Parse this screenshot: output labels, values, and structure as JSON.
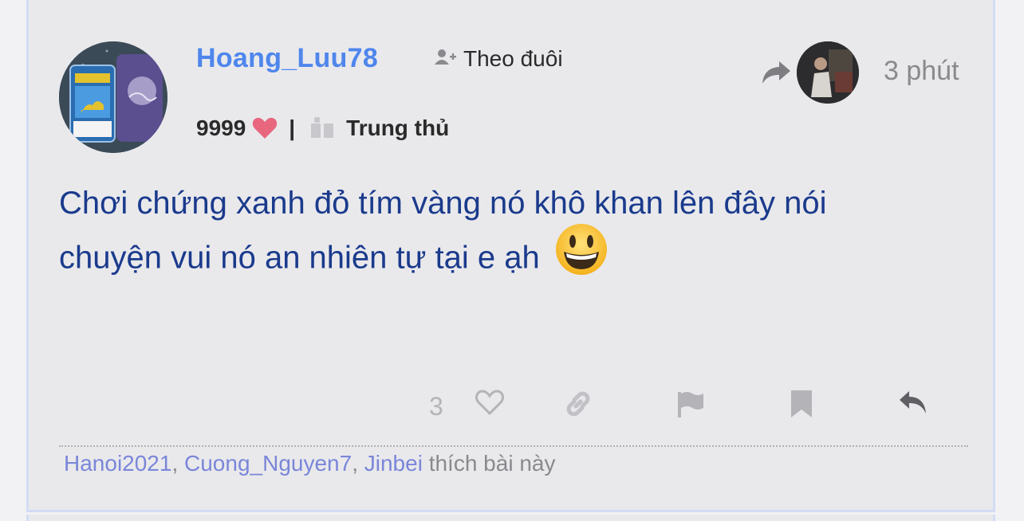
{
  "post": {
    "username": "Hoang_Luu78",
    "follow_label": "Theo đuôi",
    "stats": {
      "score": "9999",
      "rank": "Trung thủ"
    },
    "time": "3 phút",
    "content_line1": "Chơi chứng xanh đỏ tím vàng nó khô khan lên đây nói",
    "content_line2": "chuyện vui nó an nhiên tự tại e ạh",
    "like_count": "3",
    "likers": [
      "Hanoi2021",
      "Cuong_Nguyen7",
      "Jinbei"
    ],
    "likers_suffix": "thích bài này"
  },
  "icons": {
    "follow": "add-user-icon",
    "heart": "heart-icon",
    "rank": "book-icon",
    "share": "share-arrow-icon",
    "like": "heart-outline-icon",
    "link": "link-icon",
    "flag": "flag-icon",
    "bookmark": "bookmark-icon",
    "reply": "reply-icon"
  },
  "colors": {
    "username": "#4f86ec",
    "content": "#1a3a8c",
    "liker_name": "#7a86d8",
    "heart": "#e8677f",
    "muted_icon": "#c8c8cc"
  }
}
